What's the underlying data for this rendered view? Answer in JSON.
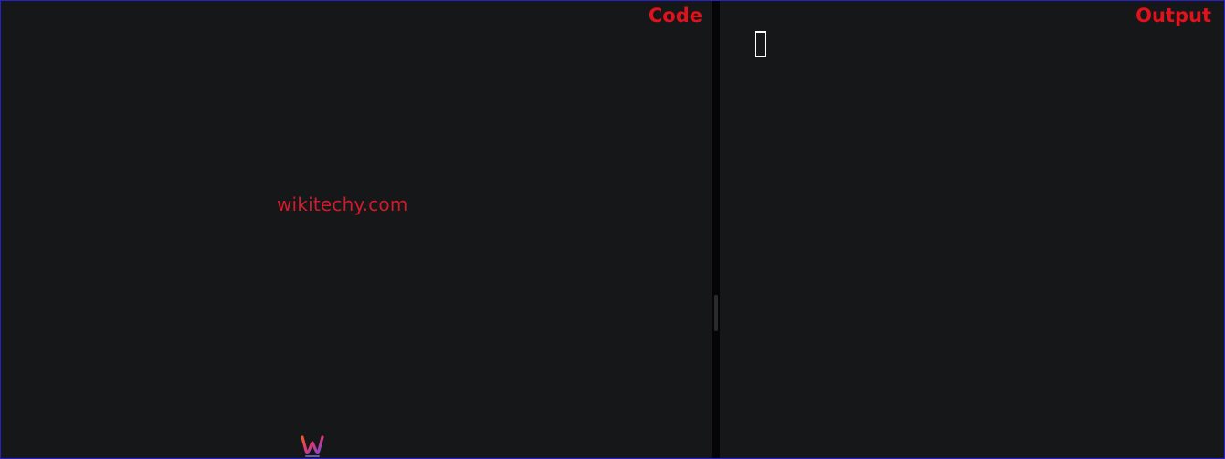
{
  "code_pane": {
    "label": "Code",
    "watermark": "wikitechy.com",
    "logo_icon": "wikitechy-w-logo-icon"
  },
  "output_pane": {
    "label": "Output",
    "rendered_glyph_icon": "missing-glyph-box-icon"
  },
  "colors": {
    "frame_border": "#2a20c8",
    "pane_background": "#161719",
    "label_red": "#e0121c",
    "watermark_red": "#d41a2a"
  }
}
